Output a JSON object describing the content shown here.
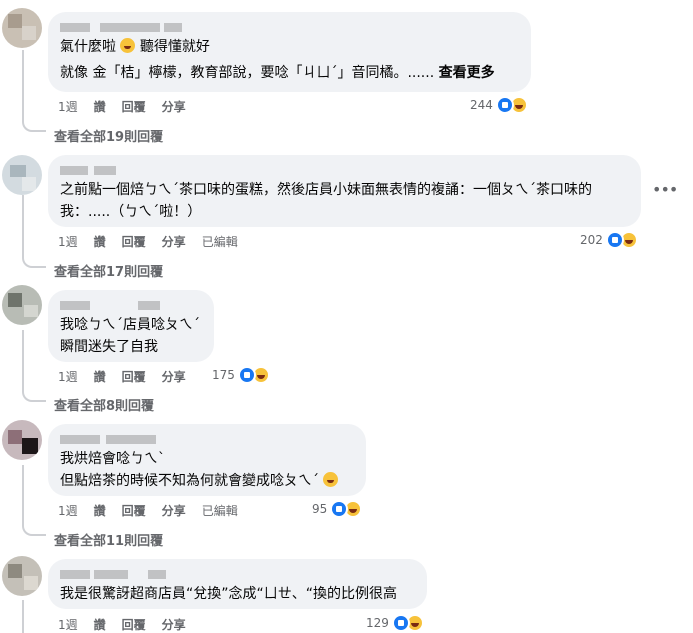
{
  "comments": [
    {
      "lines": [
        "氣什麼啦",
        "聽得懂就好",
        "就像 金「桔」檸檬，教育部說，要唸「ㄐㄩˊ」音同橘。......"
      ],
      "see_more": "查看更多",
      "time": "1週",
      "like": "讚",
      "reply": "回覆",
      "share": "分享",
      "edited": "",
      "count": "244",
      "view_replies": "查看全部19則回覆"
    },
    {
      "lines": [
        "之前點一個焙ㄅㄟˊ茶口味的蛋糕，然後店員小妹面無表情的複誦：一個ㄆㄟˊ茶口味的",
        "我：.....（ㄅㄟˊ啦！）"
      ],
      "time": "1週",
      "like": "讚",
      "reply": "回覆",
      "share": "分享",
      "edited": "已編輯",
      "count": "202",
      "view_replies": "查看全部17則回覆",
      "menu": "•••"
    },
    {
      "lines": [
        "我唸ㄅㄟˊ店員唸ㄆㄟˊ",
        "瞬間迷失了自我"
      ],
      "time": "1週",
      "like": "讚",
      "reply": "回覆",
      "share": "分享",
      "count": "175",
      "view_replies": "查看全部8則回覆"
    },
    {
      "lines": [
        "我烘焙會唸ㄅㄟˋ",
        "但點焙茶的時候不知為何就會變成唸ㄆㄟˊ"
      ],
      "time": "1週",
      "like": "讚",
      "reply": "回覆",
      "share": "分享",
      "edited": "已編輯",
      "count": "95",
      "view_replies": "查看全部11則回覆"
    },
    {
      "lines": [
        "我是很驚訝超商店員“兌換”念成“ㄩㄝ、“換的比例很高"
      ],
      "time": "1週",
      "like": "讚",
      "reply": "回覆",
      "share": "分享",
      "count": "129"
    }
  ],
  "icons": {
    "like": "like-reaction-icon",
    "haha": "haha-reaction-icon",
    "emoji": "laughing-emoji-icon",
    "menu": "more-options-icon"
  },
  "colors": {
    "bubble": "#f0f2f5",
    "meta": "#65676b",
    "like": "#1877f2",
    "haha": "#f7c23a"
  }
}
